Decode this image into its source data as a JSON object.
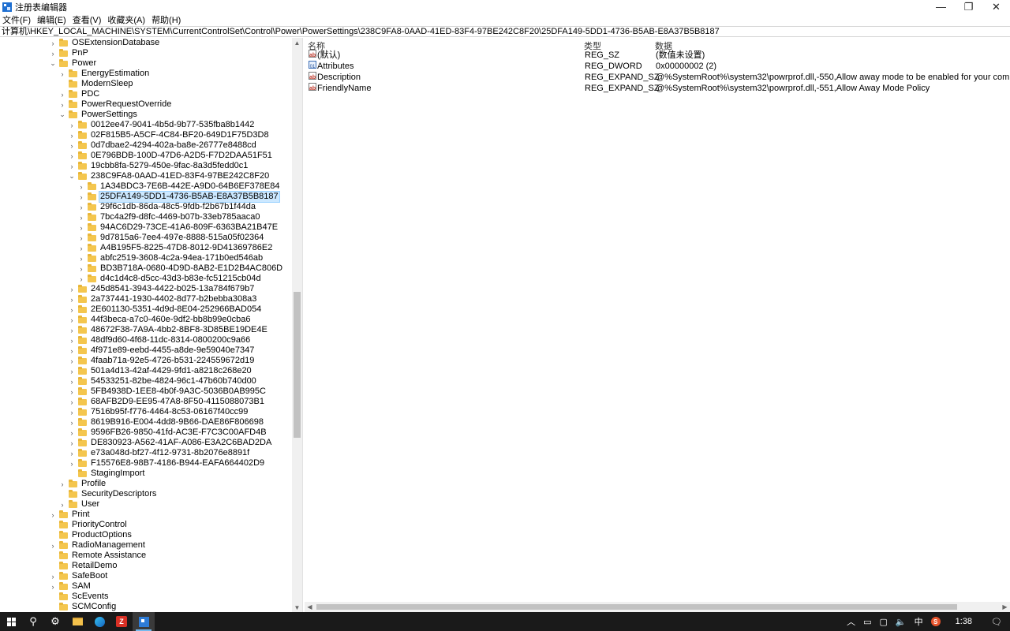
{
  "window": {
    "title": "注册表编辑器",
    "minimize_glyph": "—",
    "restore_glyph": "❐",
    "close_glyph": "✕"
  },
  "menu": [
    "文件(F)",
    "编辑(E)",
    "查看(V)",
    "收藏夹(A)",
    "帮助(H)"
  ],
  "address": "计算机\\HKEY_LOCAL_MACHINE\\SYSTEM\\CurrentControlSet\\Control\\Power\\PowerSettings\\238C9FA8-0AAD-41ED-83F4-97BE242C8F20\\25DFA149-5DD1-4736-B5AB-E8A37B5B8187",
  "tree": [
    {
      "label": "OSExtensionDatabase",
      "depth": 0,
      "toggle": "collapsed"
    },
    {
      "label": "PnP",
      "depth": 0,
      "toggle": "collapsed"
    },
    {
      "label": "Power",
      "depth": 0,
      "toggle": "expanded"
    },
    {
      "label": "EnergyEstimation",
      "depth": 1,
      "toggle": "collapsed"
    },
    {
      "label": "ModernSleep",
      "depth": 1,
      "toggle": "none"
    },
    {
      "label": "PDC",
      "depth": 1,
      "toggle": "collapsed"
    },
    {
      "label": "PowerRequestOverride",
      "depth": 1,
      "toggle": "collapsed"
    },
    {
      "label": "PowerSettings",
      "depth": 1,
      "toggle": "expanded"
    },
    {
      "label": "0012ee47-9041-4b5d-9b77-535fba8b1442",
      "depth": 2,
      "toggle": "collapsed"
    },
    {
      "label": "02F815B5-A5CF-4C84-BF20-649D1F75D3D8",
      "depth": 2,
      "toggle": "collapsed"
    },
    {
      "label": "0d7dbae2-4294-402a-ba8e-26777e8488cd",
      "depth": 2,
      "toggle": "collapsed"
    },
    {
      "label": "0E796BDB-100D-47D6-A2D5-F7D2DAA51F51",
      "depth": 2,
      "toggle": "collapsed"
    },
    {
      "label": "19cbb8fa-5279-450e-9fac-8a3d5fedd0c1",
      "depth": 2,
      "toggle": "collapsed"
    },
    {
      "label": "238C9FA8-0AAD-41ED-83F4-97BE242C8F20",
      "depth": 2,
      "toggle": "expanded"
    },
    {
      "label": "1A34BDC3-7E6B-442E-A9D0-64B6EF378E84",
      "depth": 3,
      "toggle": "collapsed"
    },
    {
      "label": "25DFA149-5DD1-4736-B5AB-E8A37B5B8187",
      "depth": 3,
      "toggle": "collapsed",
      "selected": true
    },
    {
      "label": "29f6c1db-86da-48c5-9fdb-f2b67b1f44da",
      "depth": 3,
      "toggle": "collapsed"
    },
    {
      "label": "7bc4a2f9-d8fc-4469-b07b-33eb785aaca0",
      "depth": 3,
      "toggle": "collapsed"
    },
    {
      "label": "94AC6D29-73CE-41A6-809F-6363BA21B47E",
      "depth": 3,
      "toggle": "collapsed"
    },
    {
      "label": "9d7815a6-7ee4-497e-8888-515a05f02364",
      "depth": 3,
      "toggle": "collapsed"
    },
    {
      "label": "A4B195F5-8225-47D8-8012-9D41369786E2",
      "depth": 3,
      "toggle": "collapsed"
    },
    {
      "label": "abfc2519-3608-4c2a-94ea-171b0ed546ab",
      "depth": 3,
      "toggle": "collapsed"
    },
    {
      "label": "BD3B718A-0680-4D9D-8AB2-E1D2B4AC806D",
      "depth": 3,
      "toggle": "collapsed"
    },
    {
      "label": "d4c1d4c8-d5cc-43d3-b83e-fc51215cb04d",
      "depth": 3,
      "toggle": "collapsed"
    },
    {
      "label": "245d8541-3943-4422-b025-13a784f679b7",
      "depth": 2,
      "toggle": "collapsed"
    },
    {
      "label": "2a737441-1930-4402-8d77-b2bebba308a3",
      "depth": 2,
      "toggle": "collapsed"
    },
    {
      "label": "2E601130-5351-4d9d-8E04-252966BAD054",
      "depth": 2,
      "toggle": "collapsed"
    },
    {
      "label": "44f3beca-a7c0-460e-9df2-bb8b99e0cba6",
      "depth": 2,
      "toggle": "collapsed"
    },
    {
      "label": "48672F38-7A9A-4bb2-8BF8-3D85BE19DE4E",
      "depth": 2,
      "toggle": "collapsed"
    },
    {
      "label": "48df9d60-4f68-11dc-8314-0800200c9a66",
      "depth": 2,
      "toggle": "collapsed"
    },
    {
      "label": "4f971e89-eebd-4455-a8de-9e59040e7347",
      "depth": 2,
      "toggle": "collapsed"
    },
    {
      "label": "4faab71a-92e5-4726-b531-224559672d19",
      "depth": 2,
      "toggle": "collapsed"
    },
    {
      "label": "501a4d13-42af-4429-9fd1-a8218c268e20",
      "depth": 2,
      "toggle": "collapsed"
    },
    {
      "label": "54533251-82be-4824-96c1-47b60b740d00",
      "depth": 2,
      "toggle": "collapsed"
    },
    {
      "label": "5FB4938D-1EE8-4b0f-9A3C-5036B0AB995C",
      "depth": 2,
      "toggle": "collapsed"
    },
    {
      "label": "68AFB2D9-EE95-47A8-8F50-4115088073B1",
      "depth": 2,
      "toggle": "collapsed"
    },
    {
      "label": "7516b95f-f776-4464-8c53-06167f40cc99",
      "depth": 2,
      "toggle": "collapsed"
    },
    {
      "label": "8619B916-E004-4dd8-9B66-DAE86F806698",
      "depth": 2,
      "toggle": "collapsed"
    },
    {
      "label": "9596FB26-9850-41fd-AC3E-F7C3C00AFD4B",
      "depth": 2,
      "toggle": "collapsed"
    },
    {
      "label": "DE830923-A562-41AF-A086-E3A2C6BAD2DA",
      "depth": 2,
      "toggle": "collapsed"
    },
    {
      "label": "e73a048d-bf27-4f12-9731-8b2076e8891f",
      "depth": 2,
      "toggle": "collapsed"
    },
    {
      "label": "F15576E8-98B7-4186-B944-EAFA664402D9",
      "depth": 2,
      "toggle": "collapsed"
    },
    {
      "label": "StagingImport",
      "depth": 2,
      "toggle": "none"
    },
    {
      "label": "Profile",
      "depth": 1,
      "toggle": "collapsed"
    },
    {
      "label": "SecurityDescriptors",
      "depth": 1,
      "toggle": "none"
    },
    {
      "label": "User",
      "depth": 1,
      "toggle": "collapsed"
    },
    {
      "label": "Print",
      "depth": 0,
      "toggle": "collapsed"
    },
    {
      "label": "PriorityControl",
      "depth": 0,
      "toggle": "none"
    },
    {
      "label": "ProductOptions",
      "depth": 0,
      "toggle": "none"
    },
    {
      "label": "RadioManagement",
      "depth": 0,
      "toggle": "collapsed"
    },
    {
      "label": "Remote Assistance",
      "depth": 0,
      "toggle": "none"
    },
    {
      "label": "RetailDemo",
      "depth": 0,
      "toggle": "none"
    },
    {
      "label": "SafeBoot",
      "depth": 0,
      "toggle": "collapsed"
    },
    {
      "label": "SAM",
      "depth": 0,
      "toggle": "collapsed"
    },
    {
      "label": "ScEvents",
      "depth": 0,
      "toggle": "none"
    },
    {
      "label": "SCMConfig",
      "depth": 0,
      "toggle": "none"
    }
  ],
  "values_table": {
    "headers": {
      "name": "名称",
      "type": "类型",
      "data": "数据"
    },
    "rows": [
      {
        "icon": "string-value-icon",
        "name": "(默认)",
        "type": "REG_SZ",
        "data": "(数值未设置)"
      },
      {
        "icon": "binary-value-icon",
        "name": "Attributes",
        "type": "REG_DWORD",
        "data": "0x00000002 (2)"
      },
      {
        "icon": "string-value-icon",
        "name": "Description",
        "type": "REG_EXPAND_SZ",
        "data": "@%SystemRoot%\\system32\\powrprof.dll,-550,Allow away mode to be enabled for your computer"
      },
      {
        "icon": "string-value-icon",
        "name": "FriendlyName",
        "type": "REG_EXPAND_SZ",
        "data": "@%SystemRoot%\\system32\\powrprof.dll,-551,Allow Away Mode Policy"
      }
    ]
  },
  "taskbar": {
    "clock": "1:38",
    "ime": "中",
    "icons": [
      "start-icon",
      "search-icon",
      "settings-icon",
      "file-explorer-icon",
      "edge-icon",
      "filezilla-icon",
      "regedit-icon"
    ],
    "filezilla_letter": "Z",
    "sogou_letter": "S"
  }
}
